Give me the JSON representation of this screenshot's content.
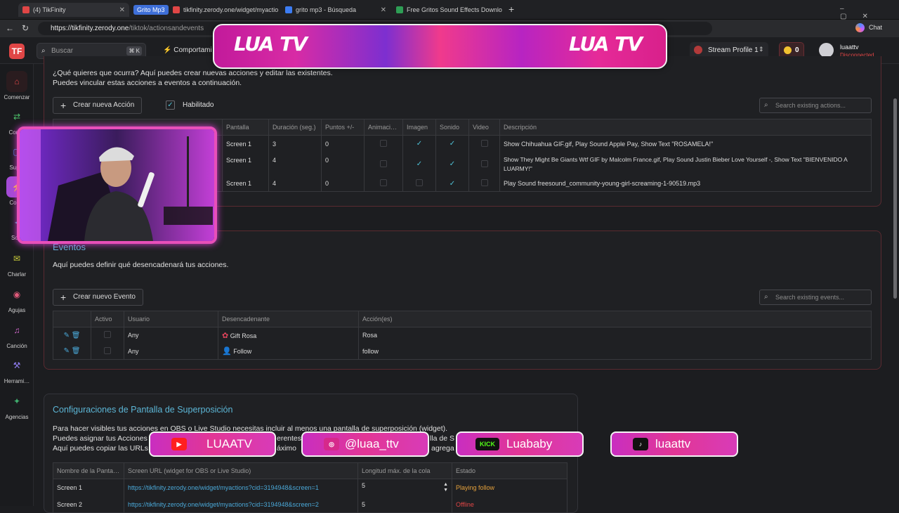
{
  "browser": {
    "tabs": [
      {
        "label": "(4) TikFinity",
        "fav_color": "#e04646"
      },
      {
        "label": "tikfinity.zerody.one/widget/myactio",
        "fav_color": "#e04646"
      },
      {
        "label": "grito mp3 - Búsqueda",
        "fav_color": "#3c7cf2"
      },
      {
        "label": "Free Gritos Sound Effects Downlo",
        "fav_color": "#2e9e55"
      }
    ],
    "tab_pill": "Grito Mp3",
    "new_tab": "+",
    "url_host": "https://tikfinity.zerody.one",
    "url_path": "/tiktok/actionsandevents",
    "chat_label": "Chat"
  },
  "app": {
    "logo": "TF",
    "search_placeholder": "Buscar",
    "search_kbd": "⌘ K",
    "nav_behavior": "Comportami",
    "stream_profile": "Stream Profile 1",
    "coins": "0",
    "username": "luaattv",
    "user_status": "Disconnected"
  },
  "sidebar": [
    {
      "label": "Comenzar",
      "icon": "home-icon",
      "glyph": "⌂"
    },
    {
      "label": "Config",
      "icon": "settings-icon",
      "glyph": "⇄"
    },
    {
      "label": "Super",
      "icon": "overlay-icon",
      "glyph": "▢"
    },
    {
      "label": "Comp",
      "icon": "behavior-icon",
      "glyph": "⚡"
    },
    {
      "label": "Soni",
      "icon": "sound-icon",
      "glyph": "◂"
    },
    {
      "label": "Charlar",
      "icon": "chat-icon",
      "glyph": "✉"
    },
    {
      "label": "Agujas",
      "icon": "gauge-icon",
      "glyph": "◉"
    },
    {
      "label": "Canción",
      "icon": "song-icon",
      "glyph": "♫"
    },
    {
      "label": "Herrami…",
      "icon": "tools-icon",
      "glyph": "⚒"
    },
    {
      "label": "Agencias",
      "icon": "agency-icon",
      "glyph": "✦"
    }
  ],
  "actions": {
    "intro1": "¿Qué quieres que ocurra? Aquí puedes crear nuevas acciones y editar las existentes.",
    "intro2": "Puedes vincular estas acciones a eventos a continuación.",
    "create_btn": "Crear nueva Acción",
    "enabled_label": "Habilitado",
    "search_placeholder": "Search existing actions...",
    "columns": [
      "Pantalla",
      "Duración (seg.)",
      "Puntos +/-",
      "Animaci…",
      "Imagen",
      "Sonido",
      "Video",
      "Descripción"
    ],
    "rows": [
      {
        "screen": "Screen 1",
        "duration": "3",
        "points": "0",
        "desc": "Show Chihuahua GIF.gif, Play Sound Apple Pay, Show Text \"ROSAMELA!\""
      },
      {
        "screen": "Screen 1",
        "duration": "4",
        "points": "0",
        "desc": "Show They Might Be Giants Wtf GIF by Malcolm France.gif, Play Sound Justin Bieber Love Yourself -, Show Text \"BIENVENIDO A",
        "desc2": "LUARMY!\""
      },
      {
        "screen": "Screen 1",
        "duration": "4",
        "points": "0",
        "desc": "Play Sound freesound_community-young-girl-screaming-1-90519.mp3"
      }
    ]
  },
  "events": {
    "title": "Eventos",
    "intro": "Aquí puedes definir qué desencadenará tus acciones.",
    "create_btn": "Crear nuevo Evento",
    "search_placeholder": "Search existing events...",
    "columns": [
      "Activo",
      "Usuario",
      "Desencadenante",
      "Acción(es)"
    ],
    "rows": [
      {
        "user": "Any",
        "trigger": "Gift Rosa",
        "action": "Rosa"
      },
      {
        "user": "Any",
        "trigger": "Follow",
        "action": "follow"
      }
    ]
  },
  "overlay": {
    "title": "Configuraciones de Pantalla de Superposición",
    "line1": "Para hacer visibles tus acciones en OBS o Live Studio necesitas incluir al menos una pantalla de superposición (widget).",
    "line2a": "Puedes asignar tus Acciones",
    "line2b": "erentes",
    "line2c": "lla de S",
    "line3a": "Aquí puedes copiar las URLs",
    "line3b": "áximo",
    "line3c": "agrega",
    "columns": [
      "Nombre de la Panta…",
      "Screen URL (widget for OBS or Live Studio)",
      "Longitud máx. de la cola",
      "Estado"
    ],
    "rows": [
      {
        "name": "Screen 1",
        "url": "https://tikfinity.zerody.one/widget/myactions?cid=3194948&screen=1",
        "len": "5",
        "status": "Playing follow"
      },
      {
        "name": "Screen 2",
        "url": "https://tikfinity.zerody.one/widget/myactions?cid=3194948&screen=2",
        "len": "5",
        "status": "Offline"
      }
    ]
  },
  "stream_overlay": {
    "banner_left": "LUA TV",
    "banner_right": "LUA TV",
    "socials": [
      {
        "name": "youtube",
        "label": "LUAATV",
        "badge": "▶",
        "badge_color": "#ff1f1f"
      },
      {
        "name": "instagram",
        "label": "@luaa_ttv",
        "badge": "◎",
        "badge_color": "#d6298b"
      },
      {
        "name": "kick",
        "label": "Luababy",
        "badge": "KICK",
        "badge_color": "#111111"
      },
      {
        "name": "tiktok",
        "label": "luaattv",
        "badge": "♪",
        "badge_color": "#111111"
      }
    ]
  },
  "colors": {
    "accent": "#5cb6d6",
    "brand": "#e04646",
    "overlay_pink": "#e23695"
  }
}
